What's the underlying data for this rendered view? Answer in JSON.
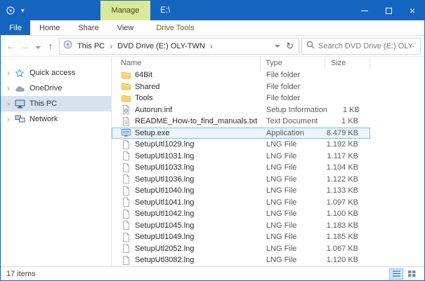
{
  "titlebar": {
    "contextual_label": "Manage",
    "title": "E:\\"
  },
  "ribbon": {
    "file_label": "File",
    "tabs": [
      "Home",
      "Share",
      "View"
    ],
    "contextual_tab": "Drive Tools"
  },
  "addressbar": {
    "breadcrumb": [
      "This PC",
      "DVD Drive (E:) OLY-TWN"
    ],
    "search_placeholder": "Search DVD Drive (E:) OLY-TWN-..."
  },
  "icons": {
    "back": "←",
    "forward": "→",
    "up": "↑",
    "refresh": "↻",
    "breadcrumb_separator": "›",
    "expander": "›",
    "close": "×"
  },
  "sidebar": {
    "items": [
      {
        "label": "Quick access",
        "icon": "star",
        "selected": false
      },
      {
        "label": "OneDrive",
        "icon": "cloud",
        "selected": false
      },
      {
        "label": "This PC",
        "icon": "computer",
        "selected": true
      },
      {
        "label": "Network",
        "icon": "network",
        "selected": false
      }
    ]
  },
  "file_list": {
    "columns": [
      "Name",
      "Type",
      "Size"
    ],
    "rows": [
      {
        "name": "64Bit",
        "type": "File folder",
        "size": "",
        "icon": "folder",
        "selected": false
      },
      {
        "name": "Shared",
        "type": "File folder",
        "size": "",
        "icon": "folder",
        "selected": false
      },
      {
        "name": "Tools",
        "type": "File folder",
        "size": "",
        "icon": "folder",
        "selected": false
      },
      {
        "name": "Autorun.inf",
        "type": "Setup Information",
        "size": "1 KB",
        "icon": "inf",
        "selected": false
      },
      {
        "name": "README_How-to_find_manuals.txt",
        "type": "Text Document",
        "size": "1 KB",
        "icon": "text",
        "selected": false
      },
      {
        "name": "Setup.exe",
        "type": "Application",
        "size": "8.479 KB",
        "icon": "exe",
        "selected": true
      },
      {
        "name": "SetupUtl1029.lng",
        "type": "LNG File",
        "size": "1.192 KB",
        "icon": "lng",
        "selected": false
      },
      {
        "name": "SetupUtl1031.lng",
        "type": "LNG File",
        "size": "1.117 KB",
        "icon": "lng",
        "selected": false
      },
      {
        "name": "SetupUtl1033.lng",
        "type": "LNG File",
        "size": "1.104 KB",
        "icon": "lng",
        "selected": false
      },
      {
        "name": "SetupUtl1036.lng",
        "type": "LNG File",
        "size": "1.122 KB",
        "icon": "lng",
        "selected": false
      },
      {
        "name": "SetupUtl1040.lng",
        "type": "LNG File",
        "size": "1.133 KB",
        "icon": "lng",
        "selected": false
      },
      {
        "name": "SetupUtl1041.lng",
        "type": "LNG File",
        "size": "1.097 KB",
        "icon": "lng",
        "selected": false
      },
      {
        "name": "SetupUtl1042.lng",
        "type": "LNG File",
        "size": "1.100 KB",
        "icon": "lng",
        "selected": false
      },
      {
        "name": "SetupUtl1045.lng",
        "type": "LNG File",
        "size": "1.183 KB",
        "icon": "lng",
        "selected": false
      },
      {
        "name": "SetupUtl1049.lng",
        "type": "LNG File",
        "size": "1.185 KB",
        "icon": "lng",
        "selected": false
      },
      {
        "name": "SetupUtl2052.lng",
        "type": "LNG File",
        "size": "1.067 KB",
        "icon": "lng",
        "selected": false
      },
      {
        "name": "SetupUtl3082.lng",
        "type": "LNG File",
        "size": "1.120 KB",
        "icon": "lng",
        "selected": false
      }
    ]
  },
  "statusbar": {
    "items_count": "17 items"
  },
  "colors": {
    "titlebar_blue": "#1565c0",
    "manage_tab_bg": "#dbe79b",
    "selection_border": "#7cc0ec",
    "selection_bg": "#eaf4fd",
    "folder_yellow": "#ffd369"
  }
}
